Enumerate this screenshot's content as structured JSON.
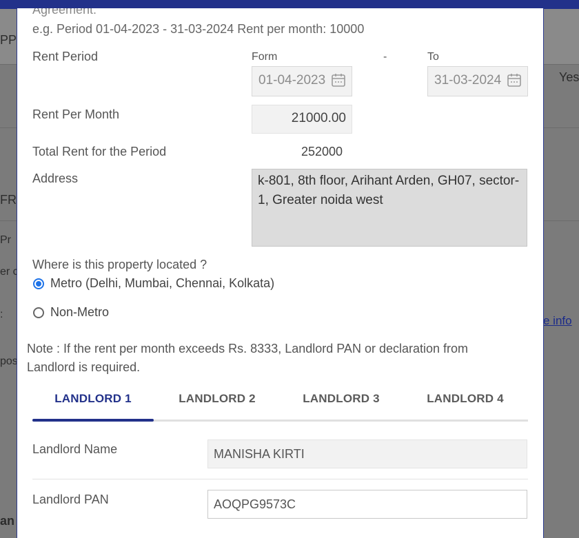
{
  "background": {
    "fragments": {
      "top_left": "PPH",
      "right_value": "Yes",
      "left_mid": "FR",
      "left_pr": "Pr",
      "left_er": "er c",
      "left_colon": ":",
      "left_pos": "pos",
      "left_bottom": "an",
      "link_right": "e info"
    }
  },
  "modal": {
    "agreement_label": "Agreement:",
    "example_text": "e.g. Period 01-04-2023 - 31-03-2024 Rent per month: 10000",
    "rent_period": {
      "label": "Rent Period",
      "from_label": "Form",
      "separator": "-",
      "to_label": "To",
      "from_value": "01-04-2023",
      "to_value": "31-03-2024"
    },
    "rent_per_month": {
      "label": "Rent Per Month",
      "value": "21000.00"
    },
    "total_rent": {
      "label": "Total Rent for the Period",
      "value": "252000"
    },
    "address": {
      "label": "Address",
      "value": "k-801, 8th floor, Arihant Arden, GH07, sector-1, Greater noida west"
    },
    "location": {
      "question": "Where is this property located ?",
      "options": [
        {
          "label": "Metro (Delhi, Mumbai, Chennai, Kolkata)",
          "selected": true
        },
        {
          "label": "Non-Metro",
          "selected": false
        }
      ]
    },
    "note": "Note : If the rent per month exceeds Rs. 8333, Landlord PAN or declaration from Landlord is required.",
    "tabs": [
      {
        "label": "LANDLORD 1",
        "active": true
      },
      {
        "label": "LANDLORD 2",
        "active": false
      },
      {
        "label": "LANDLORD 3",
        "active": false
      },
      {
        "label": "LANDLORD 4",
        "active": false
      }
    ],
    "landlord": {
      "name_label": "Landlord Name",
      "name_value": "MANISHA KIRTI",
      "pan_label": "Landlord PAN",
      "pan_value": "AOQPG9573C"
    }
  },
  "colors": {
    "accent": "#22318a",
    "radio_selected": "#1e73e8"
  }
}
